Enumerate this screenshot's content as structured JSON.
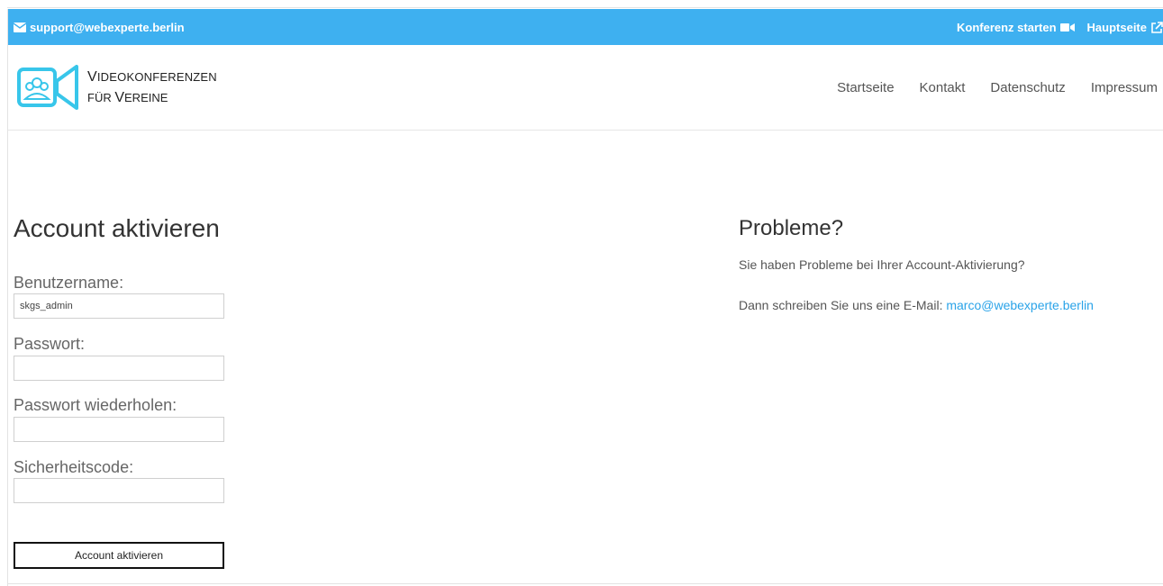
{
  "topbar": {
    "email": "support@webexperte.berlin",
    "conference_label": "Konferenz starten",
    "main_label": "Hauptseite",
    "bg_color": "#3eb0f0"
  },
  "logo": {
    "line1_cap": "V",
    "line1_rest": "IDEOKONFERENZEN",
    "line2_pre": "FÜR ",
    "line2_cap": "V",
    "line2_rest": "EREINE"
  },
  "nav": {
    "items": [
      "Startseite",
      "Kontakt",
      "Datenschutz",
      "Impressum"
    ]
  },
  "form": {
    "title": "Account aktivieren",
    "username_label": "Benutzername:",
    "username_value": "skgs_admin",
    "password_label": "Passwort:",
    "password_value": "",
    "password_repeat_label": "Passwort wiederholen:",
    "password_repeat_value": "",
    "security_label": "Sicherheitscode:",
    "security_value": "",
    "submit_label": "Account aktivieren"
  },
  "help": {
    "title": "Probleme?",
    "line1": "Sie haben Probleme bei Ihrer Account-Aktivierung?",
    "line2_prefix": "Dann schreiben Sie uns eine E-Mail: ",
    "email": "marco@webexperte.berlin",
    "link_color": "#2aa3e8"
  }
}
